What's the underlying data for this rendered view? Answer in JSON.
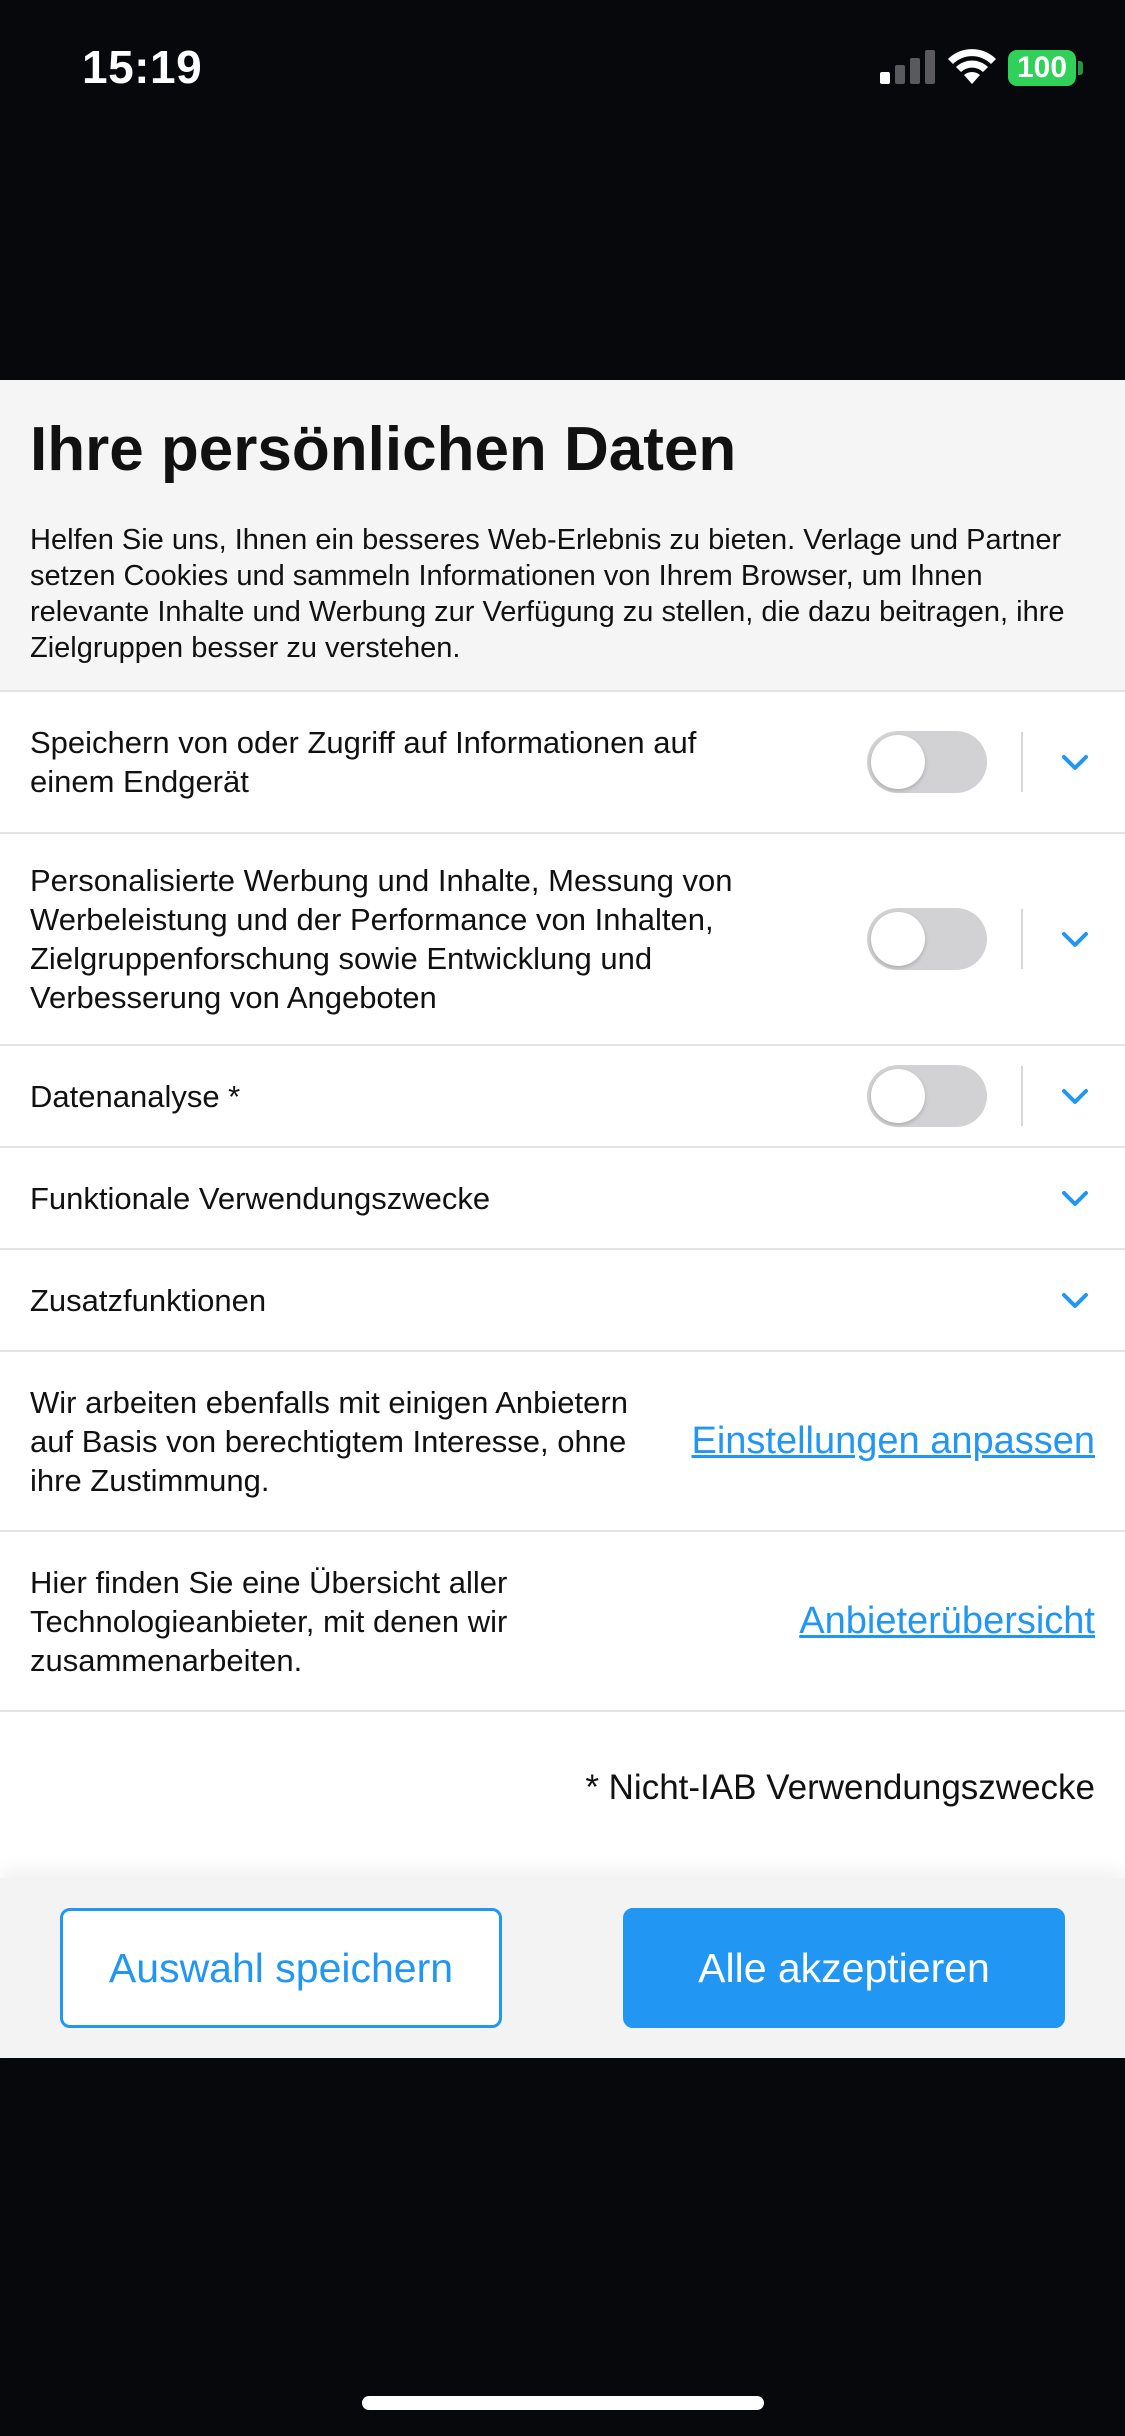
{
  "status_bar": {
    "time": "15:19",
    "battery": "100"
  },
  "consent": {
    "title": "Ihre persönlichen Daten",
    "intro": "Helfen Sie uns, Ihnen ein besseres Web-Erlebnis zu bieten. Verlage und Partner setzen Cookies und sammeln Informationen von Ihrem Browser, um Ihnen relevante Inhalte und Werbung zur Verfügung zu stellen, die dazu beitragen, ihre Zielgruppen besser zu verstehen.",
    "purposes": [
      {
        "label": "Speichern von oder Zugriff auf Informationen auf einem Endgerät",
        "enabled": false
      },
      {
        "label": "Personalisierte Werbung und Inhalte, Messung von Werbeleistung und der Performance von Inhalten, Zielgruppenforschung sowie Entwicklung und Verbesserung von Angeboten",
        "enabled": false
      },
      {
        "label": "Datenanalyse *",
        "enabled": false
      },
      {
        "label": "Funktionale Verwendungszwecke"
      },
      {
        "label": "Zusatzfunktionen"
      }
    ],
    "legitimate_interest": {
      "text": "Wir arbeiten ebenfalls mit einigen Anbietern auf Basis von berechtigtem Interesse, ohne ihre Zustimmung.",
      "link": "Einstellungen anpassen"
    },
    "vendors": {
      "text": "Hier finden Sie eine Übersicht aller Technologieanbieter, mit denen wir zusammenarbeiten.",
      "link": "Anbieterübersicht"
    },
    "footnote": "* Nicht-IAB Verwendungszwecke"
  },
  "footer": {
    "save_label": "Auswahl speichern",
    "accept_label": "Alle akzeptieren"
  },
  "colors": {
    "accent": "#2196f3",
    "toggle_off": "#d2d2d4",
    "battery": "#30d158"
  }
}
